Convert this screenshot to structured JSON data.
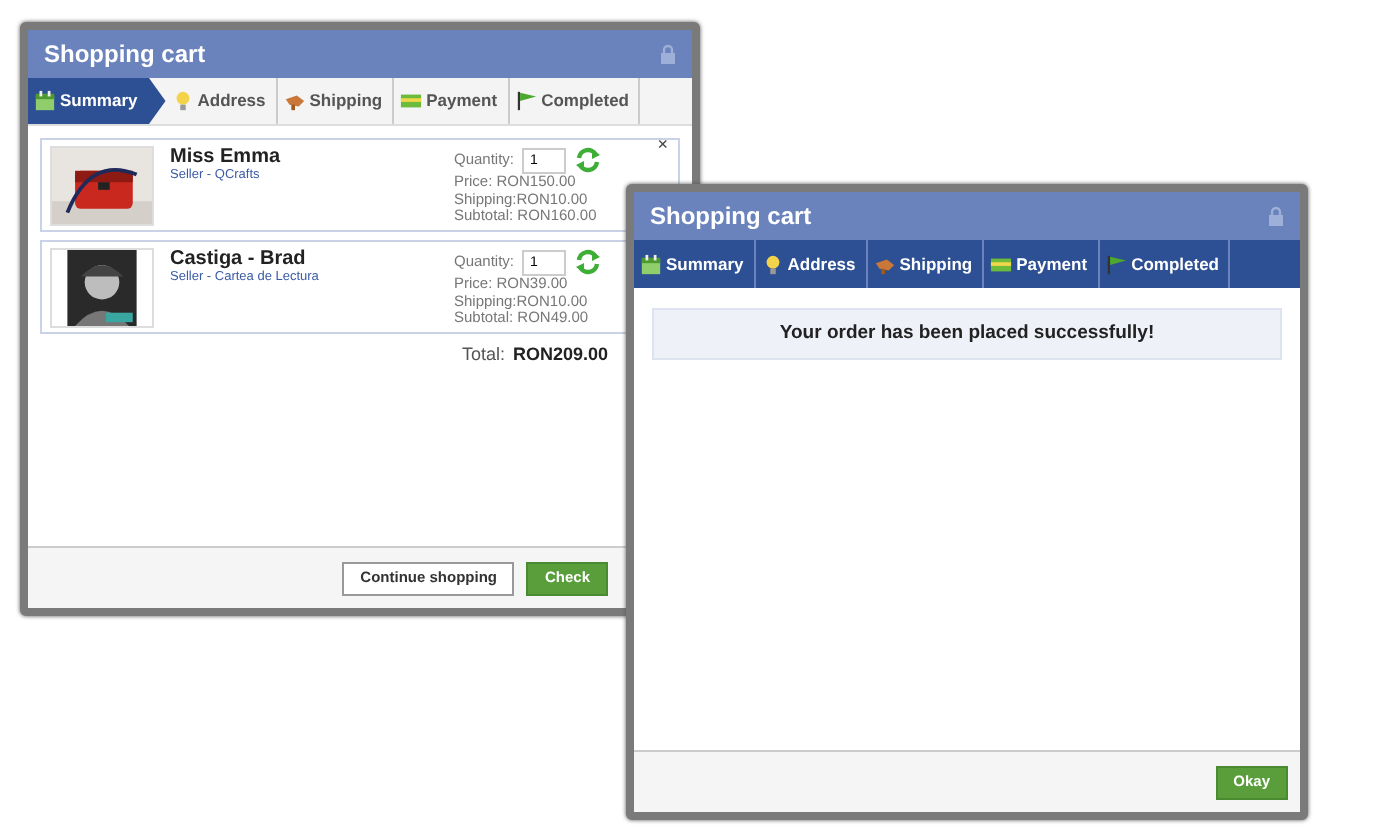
{
  "windows": [
    {
      "title": "Shopping cart",
      "steps": [
        {
          "label": "Summary",
          "selected": true
        },
        {
          "label": "Address",
          "selected": false
        },
        {
          "label": "Shipping",
          "selected": false
        },
        {
          "label": "Payment",
          "selected": false
        },
        {
          "label": "Completed",
          "selected": false
        }
      ],
      "items": [
        {
          "kind": "picture",
          "name": "Miss Emma",
          "seller": "Seller - QCrafts",
          "quantity_label": "Quantity:",
          "quantity": "1",
          "price": "Price: RON150.00",
          "shipping": "Shipping:RON10.00",
          "subtotal": "Subtotal: RON160.00"
        },
        {
          "kind": "picture",
          "name": "Castiga - Brad",
          "seller": "Seller - Cartea de Lectura",
          "quantity_label": "Quantity:",
          "quantity": "1",
          "price": "Price: RON39.00",
          "shipping": "Shipping:RON10.00",
          "subtotal": "Subtotal: RON49.00"
        }
      ],
      "close": "×",
      "total_label": "Total:",
      "total": "RON209.00",
      "buttons": [
        {
          "label": "Continue shopping",
          "kind": "default"
        },
        {
          "label": "Check",
          "kind": "success"
        }
      ]
    },
    {
      "title": "Shopping cart",
      "steps": [
        {
          "label": "Summary",
          "done": true
        },
        {
          "label": "Address",
          "done": true
        },
        {
          "label": "Shipping",
          "done": true
        },
        {
          "label": "Payment",
          "done": true
        },
        {
          "label": "Completed",
          "done": true
        }
      ],
      "message": "Your order has been placed successfully!",
      "buttons": [
        {
          "label": "Okay",
          "kind": "success"
        }
      ]
    }
  ]
}
